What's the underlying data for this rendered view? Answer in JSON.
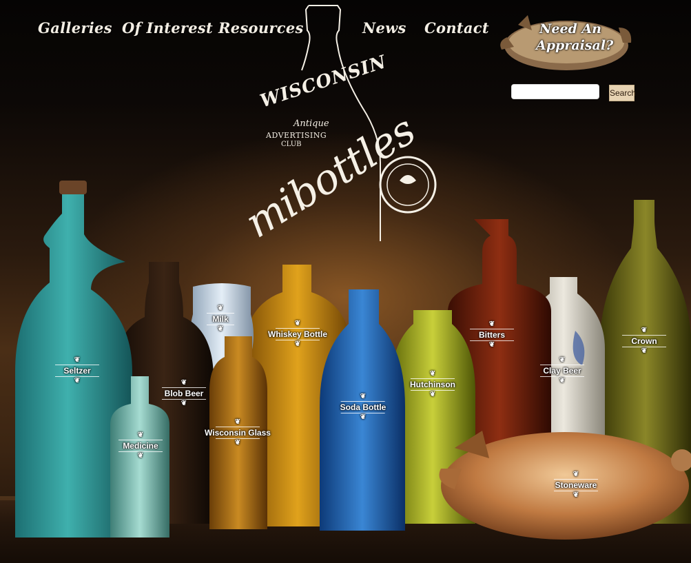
{
  "nav": {
    "items": [
      {
        "label": "Galleries"
      },
      {
        "label": "Of Interest"
      },
      {
        "label": "Resources"
      },
      {
        "label": "News"
      },
      {
        "label": "Contact"
      }
    ]
  },
  "appraisal": {
    "line1": "Need An",
    "line2": "Appraisal?"
  },
  "search": {
    "placeholder": "",
    "button_label": "Search"
  },
  "logo": {
    "club_line1": "Wisconsin",
    "club_line2": "Antique",
    "club_line3": "Advertising",
    "club_line4": "Club",
    "wordmark": "mibottles"
  },
  "bottles": [
    {
      "name": "seltzer",
      "label": "Seltzer"
    },
    {
      "name": "medicine",
      "label": "Medicine"
    },
    {
      "name": "blob-beer",
      "label": "Blob Beer"
    },
    {
      "name": "milk",
      "label": "Milk"
    },
    {
      "name": "wisconsin-glass",
      "label": "Wisconsin Glass"
    },
    {
      "name": "whiskey-bottle",
      "label": "Whiskey Bottle"
    },
    {
      "name": "soda-bottle",
      "label": "Soda Bottle"
    },
    {
      "name": "hutchinson",
      "label": "Hutchinson"
    },
    {
      "name": "bitters",
      "label": "Bitters"
    },
    {
      "name": "clay-beer",
      "label": "Clay Beer"
    },
    {
      "name": "crown",
      "label": "Crown"
    },
    {
      "name": "stoneware",
      "label": "Stoneware"
    }
  ],
  "colors": {
    "seltzer": "#2a8f8f",
    "medicine": "#6fb4a8",
    "blob_beer": "#2a1a10",
    "milk": "#c9d8e6",
    "wisconsin_glass": "#b47a1a",
    "whiskey": "#c78a12",
    "soda": "#1f5fa8",
    "hutchinson": "#a8b01e",
    "bitters": "#6a1e0c",
    "clay_beer": "#d8d4c8",
    "crown": "#6d6a1e",
    "stoneware": "#c8874a"
  }
}
